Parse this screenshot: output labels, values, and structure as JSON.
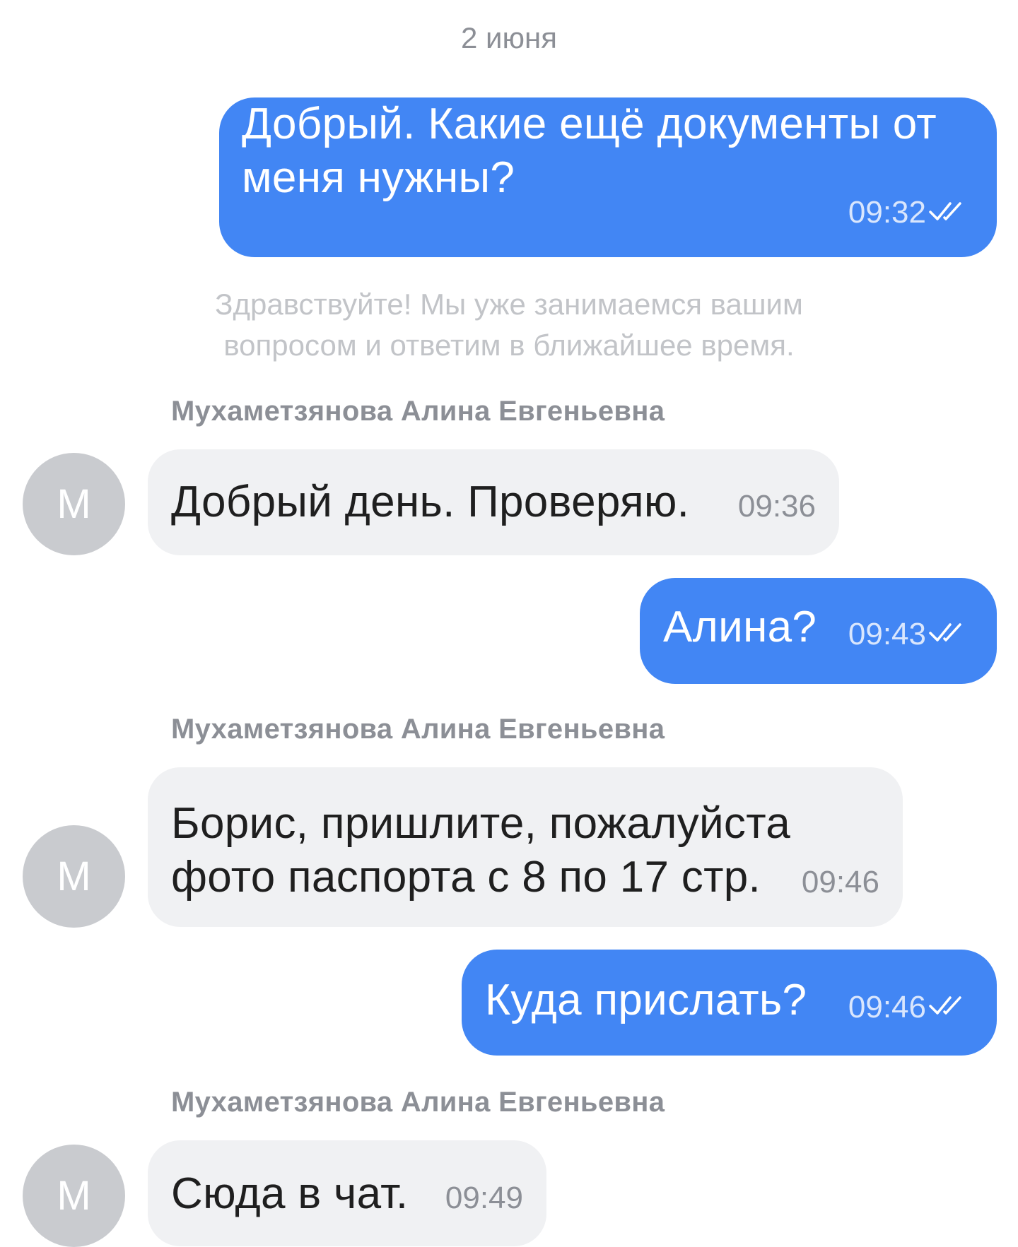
{
  "date_label": "2 июня",
  "system_message": "Здравствуйте! Мы уже занимаемся вашим вопросом и ответим в ближайшее время.",
  "messages": [
    {
      "direction": "out",
      "text": "Добрый. Какие ещё документы от меня нужны?",
      "time": "09:32",
      "status": "read"
    },
    {
      "direction": "in",
      "sender": "Мухаметзянова Алина Евгеньевна",
      "avatar": "М",
      "text": "Добрый день. Проверяю.",
      "time": "09:36"
    },
    {
      "direction": "out",
      "text": "Алина?",
      "time": "09:43",
      "status": "read"
    },
    {
      "direction": "in",
      "sender": "Мухаметзянова Алина Евгеньевна",
      "avatar": "М",
      "text": "Борис, пришлите, пожалуйста фото паспорта с 8 по 17 стр.",
      "time": "09:46"
    },
    {
      "direction": "out",
      "text": "Куда прислать?",
      "time": "09:46",
      "status": "read"
    },
    {
      "direction": "in",
      "sender": "Мухаметзянова Алина Евгеньевна",
      "avatar": "М",
      "text": "Сюда в чат.",
      "time": "09:49"
    }
  ],
  "colors": {
    "outgoing_bubble": "#4286f4",
    "incoming_bubble": "#f0f1f3",
    "avatar": "#c9cbcf",
    "secondary_text": "#8c8f96"
  },
  "icons": {
    "read_status": "double-check-icon"
  }
}
